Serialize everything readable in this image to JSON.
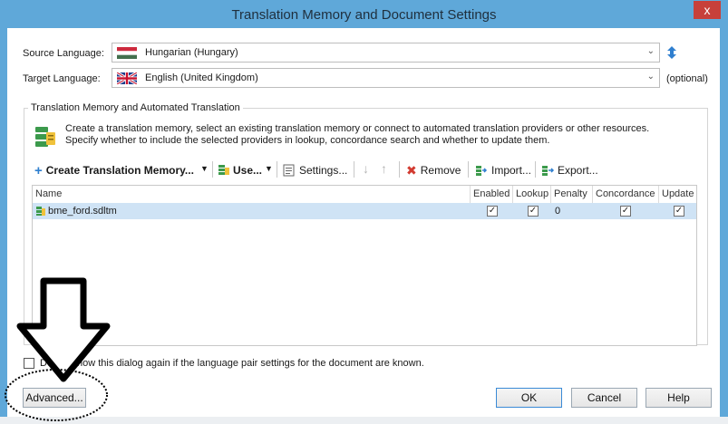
{
  "window": {
    "title": "Translation Memory and Document Settings",
    "close_glyph": "x"
  },
  "languages": {
    "source_label": "Source Language:",
    "source_value": "Hungarian (Hungary)",
    "target_label": "Target Language:",
    "target_value": "English (United Kingdom)",
    "target_note": "(optional)",
    "swap_icon": "swap-arrows-icon"
  },
  "tm_group": {
    "title": "Translation Memory and Automated Translation",
    "description_line1": "Create a translation memory, select an existing translation memory or connect to automated translation providers or other resources.",
    "description_line2": "Specify whether to include the selected providers in lookup, concordance search and whether to update them."
  },
  "toolbar": {
    "create_label": "Create Translation Memory...",
    "use_label": "Use...",
    "settings_label": "Settings...",
    "remove_label": "Remove",
    "import_label": "Import...",
    "export_label": "Export..."
  },
  "grid": {
    "columns": [
      "Name",
      "Enabled",
      "Lookup",
      "Penalty",
      "Concordance",
      "Update"
    ],
    "rows": [
      {
        "name": "bme_ford.sdltm",
        "enabled": "✓",
        "lookup": "✓",
        "penalty": "0",
        "concordance": "✓",
        "update": "✓"
      }
    ]
  },
  "footer": {
    "dont_show_label": "Do not show this dialog again if the language pair settings for the document are known.",
    "advanced_label": "Advanced...",
    "ok_label": "OK",
    "cancel_label": "Cancel",
    "help_label": "Help"
  },
  "colors": {
    "frame": "#5fa8d9",
    "close": "#c7403a",
    "row_selected": "#cfe3f5"
  }
}
